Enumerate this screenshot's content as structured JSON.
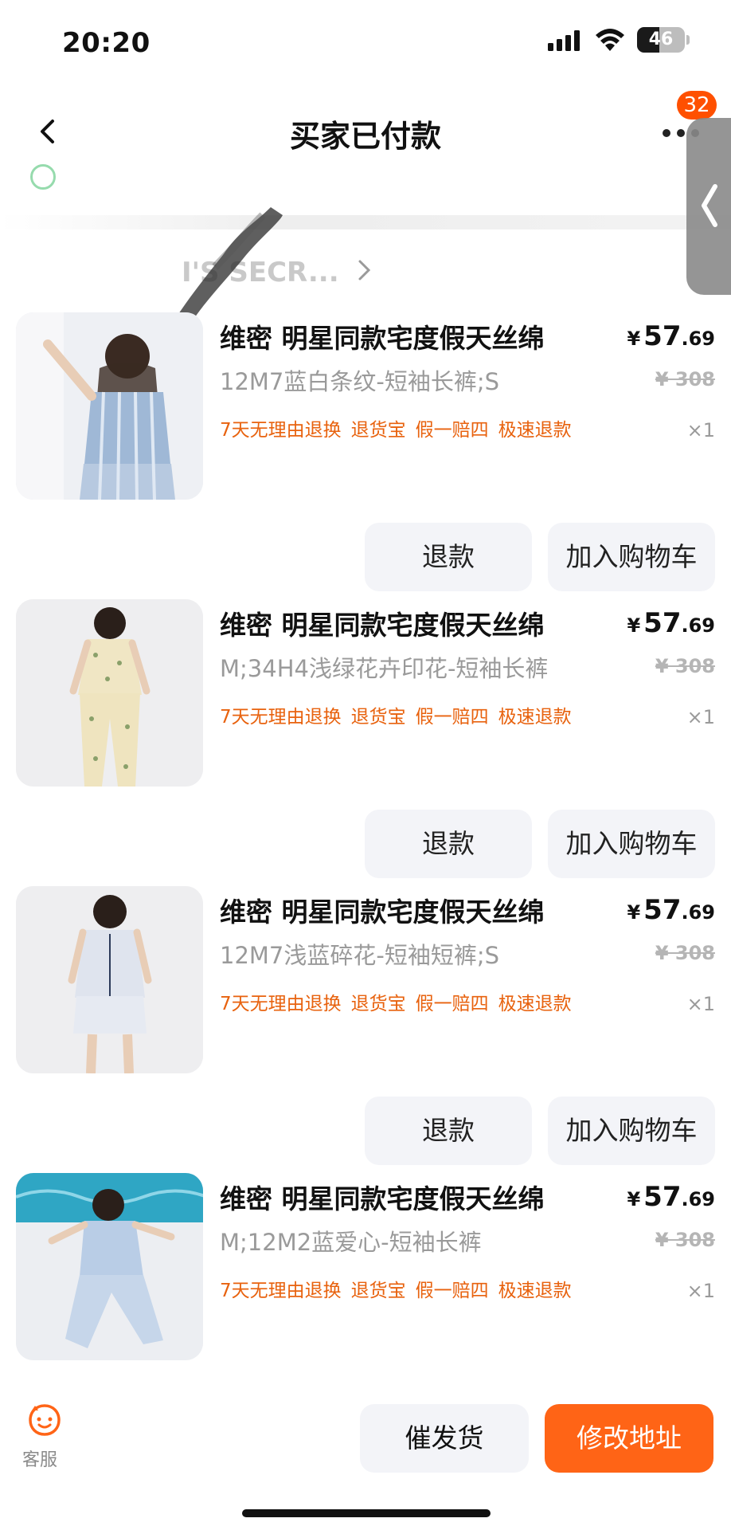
{
  "status_bar": {
    "time": "20:20",
    "battery": "46",
    "battery_level": 0.46
  },
  "nav": {
    "title": "买家已付款",
    "badge_count": "32"
  },
  "background_ghost": {
    "shop_name": "I'S SECR..."
  },
  "products": [
    {
      "title": "维密 明星同款宅度假天丝绵",
      "sku": "12M7蓝白条纹-短袖长裤;S",
      "tags": [
        "7天无理由退换",
        "退货宝",
        "假一赔四",
        "极速退款"
      ],
      "price_symbol": "¥",
      "price_int": "57",
      "price_dec": ".69",
      "original_price": "¥ 308",
      "quantity": "×1",
      "refund_label": "退款",
      "cart_label": "加入购物车",
      "image_icon": "pajama-photo-striped"
    },
    {
      "title": "维密 明星同款宅度假天丝绵",
      "sku": "M;34H4浅绿花卉印花-短袖长裤",
      "tags": [
        "7天无理由退换",
        "退货宝",
        "假一赔四",
        "极速退款"
      ],
      "price_symbol": "¥",
      "price_int": "57",
      "price_dec": ".69",
      "original_price": "¥ 308",
      "quantity": "×1",
      "refund_label": "退款",
      "cart_label": "加入购物车",
      "image_icon": "pajama-photo-floral"
    },
    {
      "title": "维密 明星同款宅度假天丝绵",
      "sku": "12M7浅蓝碎花-短袖短裤;S",
      "tags": [
        "7天无理由退换",
        "退货宝",
        "假一赔四",
        "极速退款"
      ],
      "price_symbol": "¥",
      "price_int": "57",
      "price_dec": ".69",
      "original_price": "¥ 308",
      "quantity": "×1",
      "refund_label": "退款",
      "cart_label": "加入购物车",
      "image_icon": "pajama-photo-shorts"
    },
    {
      "title": "维密 明星同款宅度假天丝绵",
      "sku": "M;12M2蓝爱心-短袖长裤",
      "tags": [
        "7天无理由退换",
        "退货宝",
        "假一赔四",
        "极速退款"
      ],
      "price_symbol": "¥",
      "price_int": "57",
      "price_dec": ".69",
      "original_price": "¥ 308",
      "quantity": "×1",
      "image_icon": "pajama-photo-pool"
    }
  ],
  "bottom_bar": {
    "service_label": "客服",
    "urge_label": "催发货",
    "address_label": "修改地址"
  },
  "colors": {
    "accent": "#ff6416",
    "tag": "#e8620e",
    "badge": "#ff5000"
  }
}
